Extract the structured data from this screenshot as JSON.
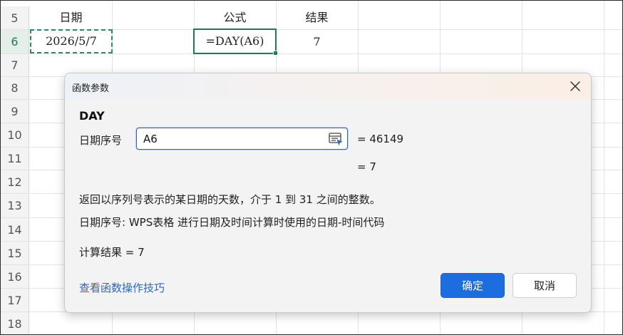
{
  "rows": [
    "5",
    "6",
    "7",
    "8",
    "9",
    "10",
    "11",
    "12",
    "13",
    "14",
    "15",
    "16",
    "17",
    "18"
  ],
  "active_row": "6",
  "cells": {
    "b5": "日期",
    "b6": "2026/5/7",
    "e5": "公式",
    "e6": "=DAY(A6)",
    "f5": "结果",
    "f6": "7"
  },
  "dialog": {
    "title": "函数参数",
    "function_name": "DAY",
    "arg_label": "日期序号",
    "arg_value": "A6",
    "arg_result": "=  46149",
    "func_result": "=  7",
    "description": "返回以序列号表示的某日期的天数，介于 1 到 31 之间的整数。",
    "arg_description": "日期序号:  WPS表格 进行日期及时间计算时使用的日期-时间代码",
    "calc_result": "计算结果  =  7",
    "help_link": "查看函数操作技巧",
    "ok_label": "确定",
    "cancel_label": "取消",
    "close_icon": "close-icon",
    "ref_icon": "range-select-icon"
  },
  "colors": {
    "selection": "#1f7a58",
    "ok_button": "#1c6ee0",
    "link": "#2a66c6"
  }
}
